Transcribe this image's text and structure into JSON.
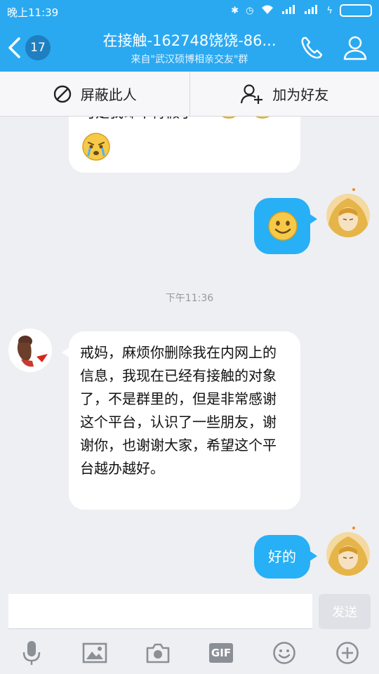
{
  "status_bar": {
    "time": "晚上11:39"
  },
  "header": {
    "back_count": "17",
    "title": "在接触-162748饶饶-86...",
    "subtitle": "来自\"武汉硕博相亲交友\"群"
  },
  "actions": {
    "block_label": "屏蔽此人",
    "add_friend_label": "加为好友"
  },
  "messages": {
    "partial_text": "可是我却不肯假了",
    "timestamp": "下午11:36",
    "incoming_text": "戒妈，麻烦你删除我在内网上的信息，我现在已经有接触的对象了，不是群里的，但是非常感谢这个平台，认识了一些朋友，谢谢你，也谢谢大家，希望这个平台越办越好。",
    "reply_text": "好的"
  },
  "composer": {
    "send_label": "发送",
    "gif_label": "GIF"
  },
  "colors": {
    "accent": "#2aa9f1",
    "bubble_out": "#27b0f5",
    "bg": "#eeeff3"
  }
}
